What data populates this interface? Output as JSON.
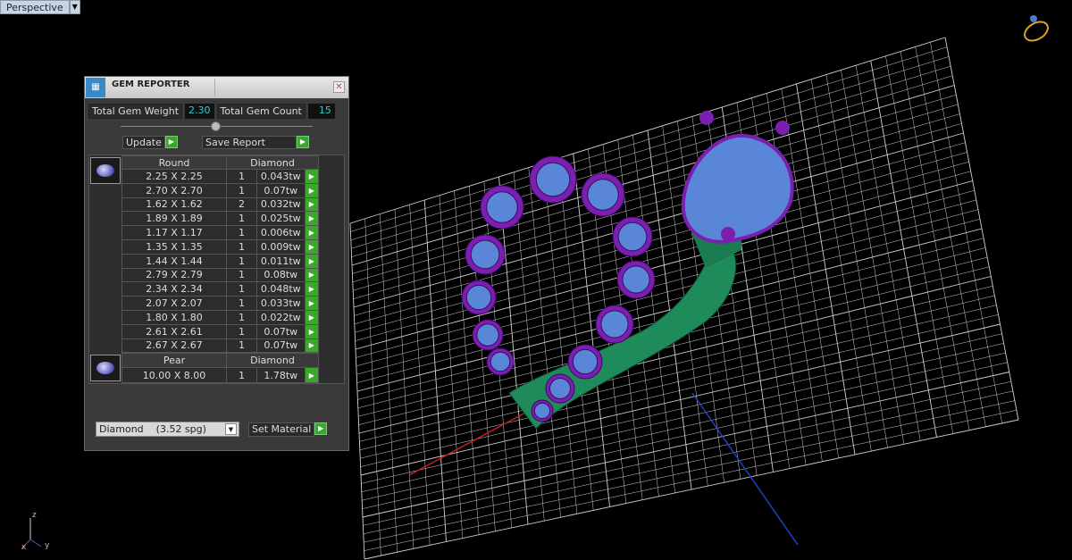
{
  "viewport": {
    "label": "Perspective"
  },
  "panel": {
    "title": "GEM REPORTER",
    "total_weight_label": "Total Gem Weight",
    "total_weight": "2.30",
    "total_count_label": "Total Gem Count",
    "total_count": "15",
    "update_label": "Update",
    "save_label": "Save Report",
    "groups": [
      {
        "shape": "Round",
        "material": "Diamond",
        "rows": [
          {
            "size": "2.25 X 2.25",
            "qty": "1",
            "weight": "0.043tw"
          },
          {
            "size": "2.70 X 2.70",
            "qty": "1",
            "weight": "0.07tw"
          },
          {
            "size": "1.62 X 1.62",
            "qty": "2",
            "weight": "0.032tw"
          },
          {
            "size": "1.89 X 1.89",
            "qty": "1",
            "weight": "0.025tw"
          },
          {
            "size": "1.17 X 1.17",
            "qty": "1",
            "weight": "0.006tw"
          },
          {
            "size": "1.35 X 1.35",
            "qty": "1",
            "weight": "0.009tw"
          },
          {
            "size": "1.44 X 1.44",
            "qty": "1",
            "weight": "0.011tw"
          },
          {
            "size": "2.79 X 2.79",
            "qty": "1",
            "weight": "0.08tw"
          },
          {
            "size": "2.34 X 2.34",
            "qty": "1",
            "weight": "0.048tw"
          },
          {
            "size": "2.07 X 2.07",
            "qty": "1",
            "weight": "0.033tw"
          },
          {
            "size": "1.80 X 1.80",
            "qty": "1",
            "weight": "0.022tw"
          },
          {
            "size": "2.61 X 2.61",
            "qty": "1",
            "weight": "0.07tw"
          },
          {
            "size": "2.67 X 2.67",
            "qty": "1",
            "weight": "0.07tw"
          }
        ]
      },
      {
        "shape": "Pear",
        "material": "Diamond",
        "rows": [
          {
            "size": "10.00 X 8.00",
            "qty": "1",
            "weight": "1.78tw"
          }
        ]
      }
    ],
    "material_select": "Diamond    (3.52 spg)",
    "set_material_label": "Set Material"
  },
  "gizmo": {
    "z": "z",
    "x": "x",
    "y": "y"
  },
  "colors": {
    "metal": "#1f8a5a",
    "bezel": "#7a1fb0",
    "gem": "#5a86d8",
    "grid": "#d0d0d0"
  }
}
